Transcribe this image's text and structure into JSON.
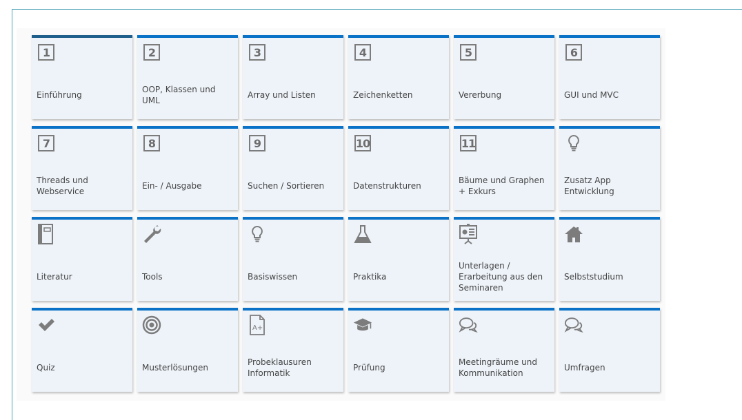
{
  "tiles": [
    {
      "icon": "number-box-icon",
      "number": "1",
      "label": "Einführung"
    },
    {
      "icon": "number-box-icon",
      "number": "2",
      "label": "OOP, Klassen und UML"
    },
    {
      "icon": "number-box-icon",
      "number": "3",
      "label": "Array und Listen"
    },
    {
      "icon": "number-box-icon",
      "number": "4",
      "label": "Zeichenketten"
    },
    {
      "icon": "number-box-icon",
      "number": "5",
      "label": "Vererbung"
    },
    {
      "icon": "number-box-icon",
      "number": "6",
      "label": "GUI und MVC"
    },
    {
      "icon": "number-box-icon",
      "number": "7",
      "label": "Threads und Webservice"
    },
    {
      "icon": "number-box-icon",
      "number": "8",
      "label": "Ein- / Ausgabe"
    },
    {
      "icon": "number-box-icon",
      "number": "9",
      "label": "Suchen / Sortieren"
    },
    {
      "icon": "number-box-icon",
      "number": "10",
      "label": "Datenstrukturen"
    },
    {
      "icon": "number-box-icon",
      "number": "11",
      "label": "Bäume und Graphen + Exkurs"
    },
    {
      "icon": "lightbulb-icon",
      "label": "Zusatz App Entwicklung"
    },
    {
      "icon": "book-icon",
      "label": "Literatur"
    },
    {
      "icon": "wrench-icon",
      "label": "Tools"
    },
    {
      "icon": "lightbulb-icon",
      "label": "Basiswissen"
    },
    {
      "icon": "flask-icon",
      "label": "Praktika"
    },
    {
      "icon": "presentation-icon",
      "label": "Unterlagen / Erarbeitung aus den Seminaren"
    },
    {
      "icon": "house-icon",
      "label": "Selbststudium"
    },
    {
      "icon": "checkmark-icon",
      "label": "Quiz"
    },
    {
      "icon": "target-icon",
      "label": "Musterlösungen"
    },
    {
      "icon": "grade-document-icon",
      "label": "Probeklausuren Informatik"
    },
    {
      "icon": "graduation-cap-icon",
      "label": "Prüfung"
    },
    {
      "icon": "chat-bubbles-icon",
      "label": "Meetingräume und Kommunikation"
    },
    {
      "icon": "chat-bubbles-icon",
      "label": "Umfragen"
    }
  ],
  "colors": {
    "accent": "#0a73c7",
    "tile_bg": "#eef3f9",
    "icon": "#7c7c7c",
    "text": "#444444"
  }
}
